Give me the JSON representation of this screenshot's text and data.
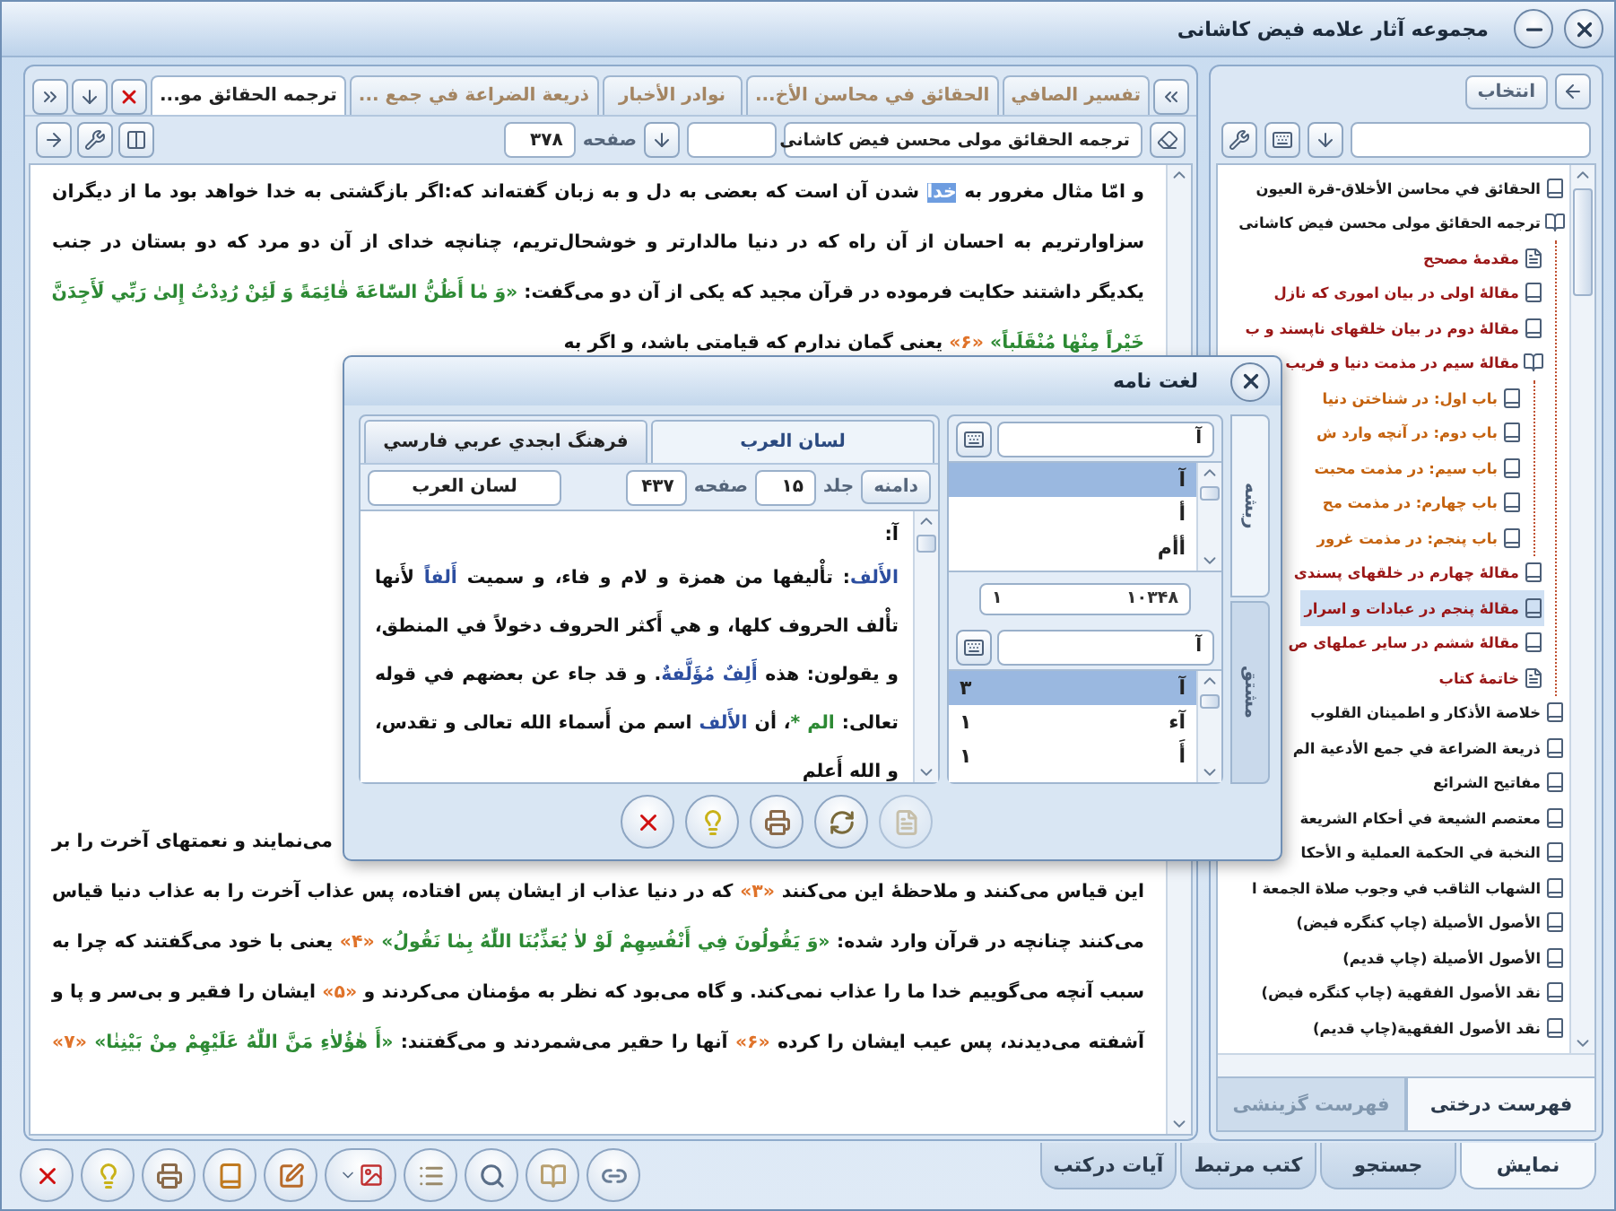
{
  "window": {
    "title": "مجموعه آثار علامه فیض کاشانی"
  },
  "document_tabs": [
    {
      "label": "تفسير الصافي",
      "selected": false
    },
    {
      "label": "الحقائق في محاسن الأخ...",
      "selected": false
    },
    {
      "label": "نوادر الأخبار",
      "selected": false
    },
    {
      "label": "ذريعة الضراعة في جمع ...",
      "selected": false
    },
    {
      "label": "ترجمه الحقائق مو...",
      "selected": true
    }
  ],
  "toolbar": {
    "book_field": "ترجمه الحقائق مولی محسن فیض کاشانی",
    "page_label": "صفحه",
    "page_value": "۳۷۸"
  },
  "text_lines": [
    {
      "kind": "full",
      "segments": [
        {
          "kind": "text",
          "text": "و امّا مثال مغرور به "
        },
        {
          "kind": "highlight",
          "text": "خدا"
        },
        {
          "kind": "text",
          "text": " شدن آن است که بعضی به دل و به زبان گفته‌اند که:اگر بازگشتی به خدا خواهد بود ما از دیگران"
        }
      ]
    },
    {
      "kind": "full",
      "segments": [
        {
          "kind": "text",
          "text": "سزاوارتریم به احسان از آن راه که در دنیا مالدارتر و خوشحال‌تریم، چنانچه خدای از آن دو مرد که دو بستان در جنب"
        }
      ]
    },
    {
      "kind": "full",
      "segments": [
        {
          "kind": "text",
          "text": "یکدیگر داشتند حکایت فرموده در قرآن مجید که یکی از آن دو می‌گفت: "
        },
        {
          "kind": "verse",
          "text": "«وَ مٰا أَظُنُّ السّٰاعَةَ قٰائِمَةً وَ لَئِنْ رُدِدْتُ إِلىٰ رَبِّي لَأَجِدَنَّ"
        }
      ]
    },
    {
      "kind": "start",
      "segments": [
        {
          "kind": "verse",
          "text": "خَيْراً مِنْهٰا مُنْقَلَباً»"
        },
        {
          "kind": "note",
          "text": " «۶» "
        },
        {
          "kind": "text",
          "text": "یعنی گمان ندارم که قیامتی باشد، و اگر به"
        }
      ]
    },
    {
      "kind": "end",
      "segments": [
        {
          "kind": "text",
          "text": "می‌نمایند و نعمتهای آخرت را بر"
        }
      ]
    },
    {
      "kind": "full",
      "segments": [
        {
          "kind": "text",
          "text": "این قیاس می‌کنند و ملاحظهٔ این می‌کنند "
        },
        {
          "kind": "note",
          "text": "«۳»"
        },
        {
          "kind": "text",
          "text": " که در دنیا عذاب از ایشان پس افتاده، پس عذاب آخرت را به عذاب دنیا قیاس"
        }
      ]
    },
    {
      "kind": "full",
      "segments": [
        {
          "kind": "text",
          "text": "می‌کنند چنانچه در قرآن وارد شده: "
        },
        {
          "kind": "verse",
          "text": "«وَ يَقُولُونَ فِي أَنْفُسِهِمْ لَوْ لاٰ يُعَذِّبُنَا اللّٰهُ بِمٰا نَقُولُ»"
        },
        {
          "kind": "note",
          "text": " «۴» "
        },
        {
          "kind": "text",
          "text": "یعنی با خود می‌گفتند که چرا به"
        }
      ]
    },
    {
      "kind": "full",
      "segments": [
        {
          "kind": "text",
          "text": "سبب آنچه می‌گوییم خدا ما را عذاب نمی‌کند. و گاه می‌بود که نظر به مؤمنان می‌کردند و "
        },
        {
          "kind": "note",
          "text": "«۵»"
        },
        {
          "kind": "text",
          "text": " ایشان را فقیر و بی‌سر و پا و"
        }
      ]
    },
    {
      "kind": "full",
      "segments": [
        {
          "kind": "text",
          "text": "آشفته می‌دیدند، پس عیب ایشان را کرده "
        },
        {
          "kind": "note",
          "text": "«۶»"
        },
        {
          "kind": "text",
          "text": " آنها را حقیر می‌شمردند و می‌گفتند: "
        },
        {
          "kind": "verse",
          "text": "«أَ هٰؤُلاٰءِ مَنَّ اللّٰهُ عَلَيْهِمْ مِنْ بَيْنِنٰا»"
        },
        {
          "kind": "note",
          "text": " «۷»"
        }
      ]
    }
  ],
  "dictionary": {
    "title": "لغت نامه",
    "tabs": [
      {
        "label": "لسان العرب",
        "selected": true
      },
      {
        "label": "فرهنگ ابجدي عربي فارسي",
        "selected": false
      }
    ],
    "domain_button": "دامنه",
    "volume_label": "جلد",
    "volume": "۱۵",
    "page_label": "صفحه",
    "page": "۴۳۷",
    "source": "لسان العرب",
    "heading": "آ:",
    "entry": [
      {
        "kind": "term",
        "text": "الأَلف"
      },
      {
        "kind": "text",
        "text": ": تأْليفها من همزة و لام و فاء، و سميت "
      },
      {
        "kind": "term",
        "text": "أَلفاً"
      },
      {
        "kind": "text",
        "text": " لأَنها تأْلف الحروف كلها، و هي أَكثر الحروف دخولاً في المنطق، و يقولون: هذه "
      },
      {
        "kind": "term",
        "text": "أَلِفٌ مُؤَلَّفةٌ"
      },
      {
        "kind": "text",
        "text": ". و قد جاء عن بعضهم في قوله تعالى: "
      },
      {
        "kind": "verse",
        "text": "الم *"
      },
      {
        "kind": "text",
        "text": "، أن "
      },
      {
        "kind": "term",
        "text": "الأَلف"
      },
      {
        "kind": "text",
        "text": " اسم من أَسماء الله تعالى و تقدس، و الله أَعلم"
      }
    ],
    "side_tabs": [
      {
        "label": "ریشه",
        "selected": true
      },
      {
        "label": "مشتق",
        "selected": false
      }
    ],
    "root_search": {
      "value": "آ"
    },
    "roots": [
      {
        "label": "آ",
        "selected": true
      },
      {
        "label": "أ",
        "selected": false
      },
      {
        "label": "أأم",
        "selected": false
      }
    ],
    "counter": {
      "total": "۱۰۳۴۸",
      "current": "۱"
    },
    "derived_search": {
      "value": "آ"
    },
    "derived": [
      {
        "label": "آ",
        "count": "۳",
        "selected": true
      },
      {
        "label": "آء",
        "count": "۱",
        "selected": false
      },
      {
        "label": "أَ",
        "count": "۱",
        "selected": false
      }
    ],
    "buttons": [
      {
        "kind": "close",
        "disabled": false
      },
      {
        "kind": "help",
        "disabled": false
      },
      {
        "kind": "print",
        "disabled": false
      },
      {
        "kind": "refresh",
        "disabled": false
      },
      {
        "kind": "page",
        "disabled": true
      }
    ]
  },
  "tree_panel": {
    "select_button": "انتخاب",
    "items": [
      {
        "label": "الحقائق في محاسن الأخلاق-قرة العيون",
        "kind": "book",
        "selected": false
      },
      {
        "label": "ترجمه الحقائق مولی محسن فیض کاشانی",
        "kind": "open-book",
        "selected": false,
        "children": [
          {
            "label": "مقدمهٔ مصحح",
            "kind": "page",
            "selected": false
          },
          {
            "label": "مقالهٔ اولی در بیان اموری که نازل",
            "kind": "book",
            "selected": false
          },
          {
            "label": "مقالهٔ دوم در بیان خلقهای ناپسند و ب",
            "kind": "book",
            "selected": false
          },
          {
            "label": "مقالهٔ سیم در مذمت دنیا و فریب",
            "kind": "open-book",
            "selected": false,
            "children": [
              {
                "label": "باب اول: در شناختن دنیا",
                "kind": "book",
                "selected": false
              },
              {
                "label": "باب دوم: در آنچه وارد ش",
                "kind": "book",
                "selected": false
              },
              {
                "label": "باب سیم: در مذمت محبت",
                "kind": "book",
                "selected": false
              },
              {
                "label": "باب چهارم: در مذمت مح",
                "kind": "book",
                "selected": false
              },
              {
                "label": "باب پنجم: در مذمت غرور",
                "kind": "book",
                "selected": false
              }
            ]
          },
          {
            "label": "مقالهٔ چهارم در خلقهای پسندی",
            "kind": "book",
            "selected": false
          },
          {
            "label": "مقالهٔ پنجم در عبادات و اسرار",
            "kind": "book",
            "selected": true
          },
          {
            "label": "مقالهٔ ششم در سایر عملهای ص",
            "kind": "book",
            "selected": false
          },
          {
            "label": "خاتمهٔ کتاب",
            "kind": "page",
            "selected": false
          }
        ]
      },
      {
        "label": "خلاصة الأذكار و اطمينان القلوب",
        "kind": "book",
        "selected": false
      },
      {
        "label": "ذريعة الضراعة في جمع الأدعية الم",
        "kind": "book",
        "selected": false
      },
      {
        "label": "مفاتيح الشرائع",
        "kind": "book",
        "selected": false
      },
      {
        "label": "معتصم الشيعة في أحكام الشريعة",
        "kind": "book",
        "selected": false
      },
      {
        "label": "النخبة في الحكمة العملية و الأحكا",
        "kind": "book",
        "selected": false
      },
      {
        "label": "الشهاب الثاقب في وجوب صلاة الجمعة ا",
        "kind": "book",
        "selected": false
      },
      {
        "label": "الأصول الأصيلة (چاپ كنگره فيض)",
        "kind": "book",
        "selected": false
      },
      {
        "label": "الأصول الأصيلة (چاپ قديم)",
        "kind": "book",
        "selected": false
      },
      {
        "label": "نقد الأصول الفقهية (چاپ كنگره فيض)",
        "kind": "book",
        "selected": false
      },
      {
        "label": "نقد الأصول الفقهية(چاپ قديم)",
        "kind": "book",
        "selected": false
      }
    ],
    "tabs": [
      {
        "label": "فهرست درختی",
        "selected": true
      },
      {
        "label": "فهرست گزینشی",
        "selected": false
      }
    ]
  },
  "toolbar_buttons": [
    {
      "kind": "close"
    },
    {
      "kind": "help"
    },
    {
      "kind": "print"
    },
    {
      "kind": "book"
    },
    {
      "kind": "edit"
    },
    {
      "kind": "picker"
    },
    {
      "kind": "list"
    },
    {
      "kind": "search"
    },
    {
      "kind": "open-book"
    },
    {
      "kind": "link"
    }
  ],
  "bottom_tabs": [
    {
      "label": "نمایش",
      "selected": true
    },
    {
      "label": "جستجو",
      "selected": false
    },
    {
      "label": "کتب مرتبط",
      "selected": false
    },
    {
      "label": "آیات درکتب",
      "selected": false
    }
  ]
}
